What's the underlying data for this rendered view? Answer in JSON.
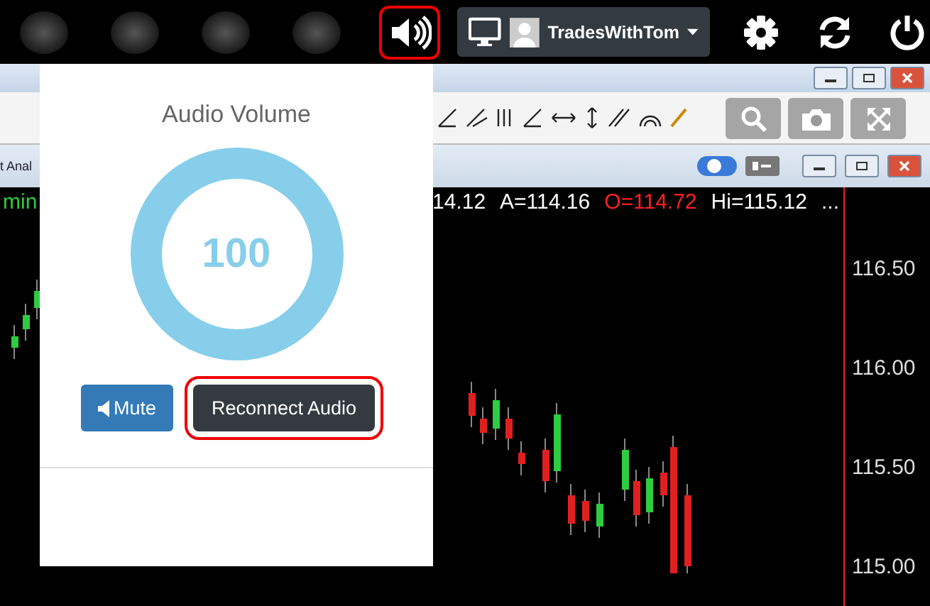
{
  "top_bar": {
    "volume_highlighted": true,
    "user": "TradesWithTom"
  },
  "remote_screen": {
    "tab_fragment": "t Anal",
    "timeframe": "min",
    "quote": [
      {
        "text": "14.12",
        "color": "#ffffff"
      },
      {
        "text": "A=114.16",
        "color": "#ffffff"
      },
      {
        "text": "O=114.72",
        "color": "#ff2020"
      },
      {
        "text": "Hi=115.12",
        "color": "#ffffff"
      },
      {
        "text": "...",
        "color": "#ffffff"
      }
    ],
    "price_axis": [
      "116.50",
      "116.00",
      "115.50",
      "115.00"
    ]
  },
  "audio_popup": {
    "title": "Audio Volume",
    "level": 1.0,
    "reading": "100",
    "buttons": [
      {
        "label": "Mute",
        "kind": "mute",
        "highlighted": false
      },
      {
        "label": "Reconnect Audio",
        "kind": "reconnect",
        "highlighted": true
      }
    ]
  }
}
